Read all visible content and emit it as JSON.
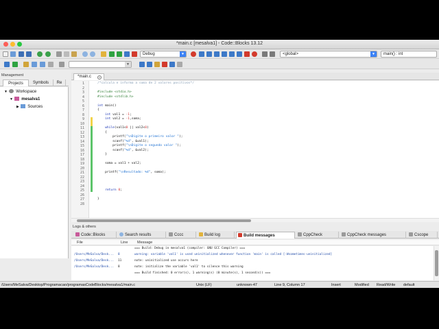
{
  "window": {
    "title": "*main.c [mesalva1] - Code::Blocks 13.12"
  },
  "toolbar": {
    "build_target": "Debug",
    "scope": "<global>",
    "function": "main() : int"
  },
  "management": {
    "label": "Management",
    "tabs": [
      "Projects",
      "Symbols",
      "Re"
    ],
    "tree": [
      "Workspace",
      "mesalva1",
      "Sources"
    ]
  },
  "editor": {
    "tab_label": "*main.c",
    "line_numbers": [
      "1",
      "2",
      "3",
      "4",
      "5",
      "6",
      "7",
      "8",
      "9",
      "10",
      "11",
      "12",
      "13",
      "14",
      "15",
      "16",
      "17",
      "18",
      "19",
      "20",
      "21",
      "22",
      "23",
      "24",
      "25",
      "26",
      "27",
      "28"
    ],
    "lines": {
      "l1": "/*calcula e informa a soma de 2 valores positivos*/",
      "l3a": "#include ",
      "l3b": "<stdio.h>",
      "l4a": "#include ",
      "l4b": "<stdlib.h>",
      "l6a": "int",
      "l6b": " main()",
      "l7": "{",
      "l8a": "    int",
      "l8b": " val1 = ",
      "l8c": "-1",
      "l8d": ";",
      "l9a": "    int",
      "l9b": " val2 = ",
      "l9c": "-1",
      "l9d": ",soma;",
      "l11a": "    while",
      "l11b": "(val1<",
      "l11c": "0",
      "l11d": " || val2<",
      "l11e": "0",
      "l11f": ")",
      "l12": "    {",
      "l13a": "        printf(",
      "l13b": "\"\\nDigite o primeiro valor \"",
      "l13c": ");",
      "l14a": "        scanf(",
      "l14b": "\"%d\"",
      "l14c": ", &val1);",
      "l15a": "        printf(",
      "l15b": "\"\\nDigite o segundo valor \"",
      "l15c": ");",
      "l16a": "        scanf(",
      "l16b": "\"%d\"",
      "l16c": ", &val2);",
      "l17": "    }",
      "l19": "    soma = val1 + val2;",
      "l21a": "    printf(",
      "l21b": "\"\\nResultado: %d\"",
      "l21c": ", soma);",
      "l25a": "    return",
      "l25b": " ",
      "l25c": "0",
      "l25d": ";",
      "l27": "}"
    }
  },
  "logs": {
    "title": "Logs & others",
    "tabs": [
      "Code::Blocks",
      "Search results",
      "Cccc",
      "Build log",
      "Build messages",
      "CppCheck",
      "CppCheck messages",
      "Cscope"
    ],
    "columns": [
      "File",
      "Line",
      "Message"
    ],
    "rows": [
      {
        "file": "",
        "line": "",
        "message": "=== Build: Debug in mesalva1 (compiler: GNU GCC Compiler) ==="
      },
      {
        "file": "/Users/MeSalva/Desk...",
        "line": "8",
        "message": "warning: variable 'val1' is used uninitialized whenever function 'main' is called [-Wsometimes-uninitialized]"
      },
      {
        "file": "/Users/MeSalva/Desk...",
        "line": "11",
        "message": "note: uninitialized use occurs here"
      },
      {
        "file": "/Users/MeSalva/Desk...",
        "line": "8",
        "message": "note: initialize the variable 'val1' to silence this warning"
      },
      {
        "file": "",
        "line": "",
        "message": "=== Build finished: 0 error(s), 1 warning(s) (0 minute(s), 1 second(s)) ==="
      }
    ]
  },
  "status": {
    "path": "/Users/MeSalva/Desktop/Programacao/programasCodeBlocks/mesalva1/main.c",
    "eol": "Unix (LF)",
    "encoding": "unknown-47",
    "position": "Line 9, Column 17",
    "mode": "Insert",
    "modified": "Modified",
    "access": "Read/Write",
    "profile": "default"
  }
}
